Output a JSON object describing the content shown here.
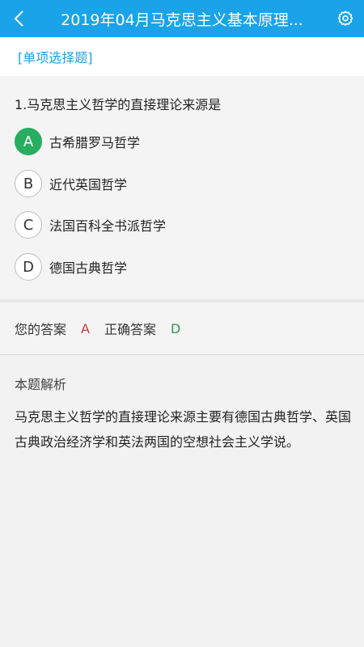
{
  "header": {
    "title": "2019年04月马克思主义基本原理...",
    "back_icon": "chevron-left-icon",
    "settings_icon": "gear-icon",
    "accent": "#1aa3e8"
  },
  "question_type": "[单项选择题]",
  "question": {
    "text": "1.马克思主义哲学的直接理论来源是",
    "options": [
      {
        "letter": "A",
        "text": "古希腊罗马哲学",
        "selected": true
      },
      {
        "letter": "B",
        "text": "近代英国哲学",
        "selected": false
      },
      {
        "letter": "C",
        "text": "法国百科全书派哲学",
        "selected": false
      },
      {
        "letter": "D",
        "text": "德国古典哲学",
        "selected": false
      }
    ]
  },
  "answer": {
    "your_label": "您的答案",
    "your_value": "A",
    "correct_label": "正确答案",
    "correct_value": "D"
  },
  "analysis": {
    "title": "本题解析",
    "body": "马克思主义哲学的直接理论来源主要有德国古典哲学、英国古典政治经济学和英法两国的空想社会主义学说。"
  },
  "colors": {
    "selected": "#27ae60",
    "wrong": "#d23a3a",
    "correct": "#2e9b40"
  }
}
